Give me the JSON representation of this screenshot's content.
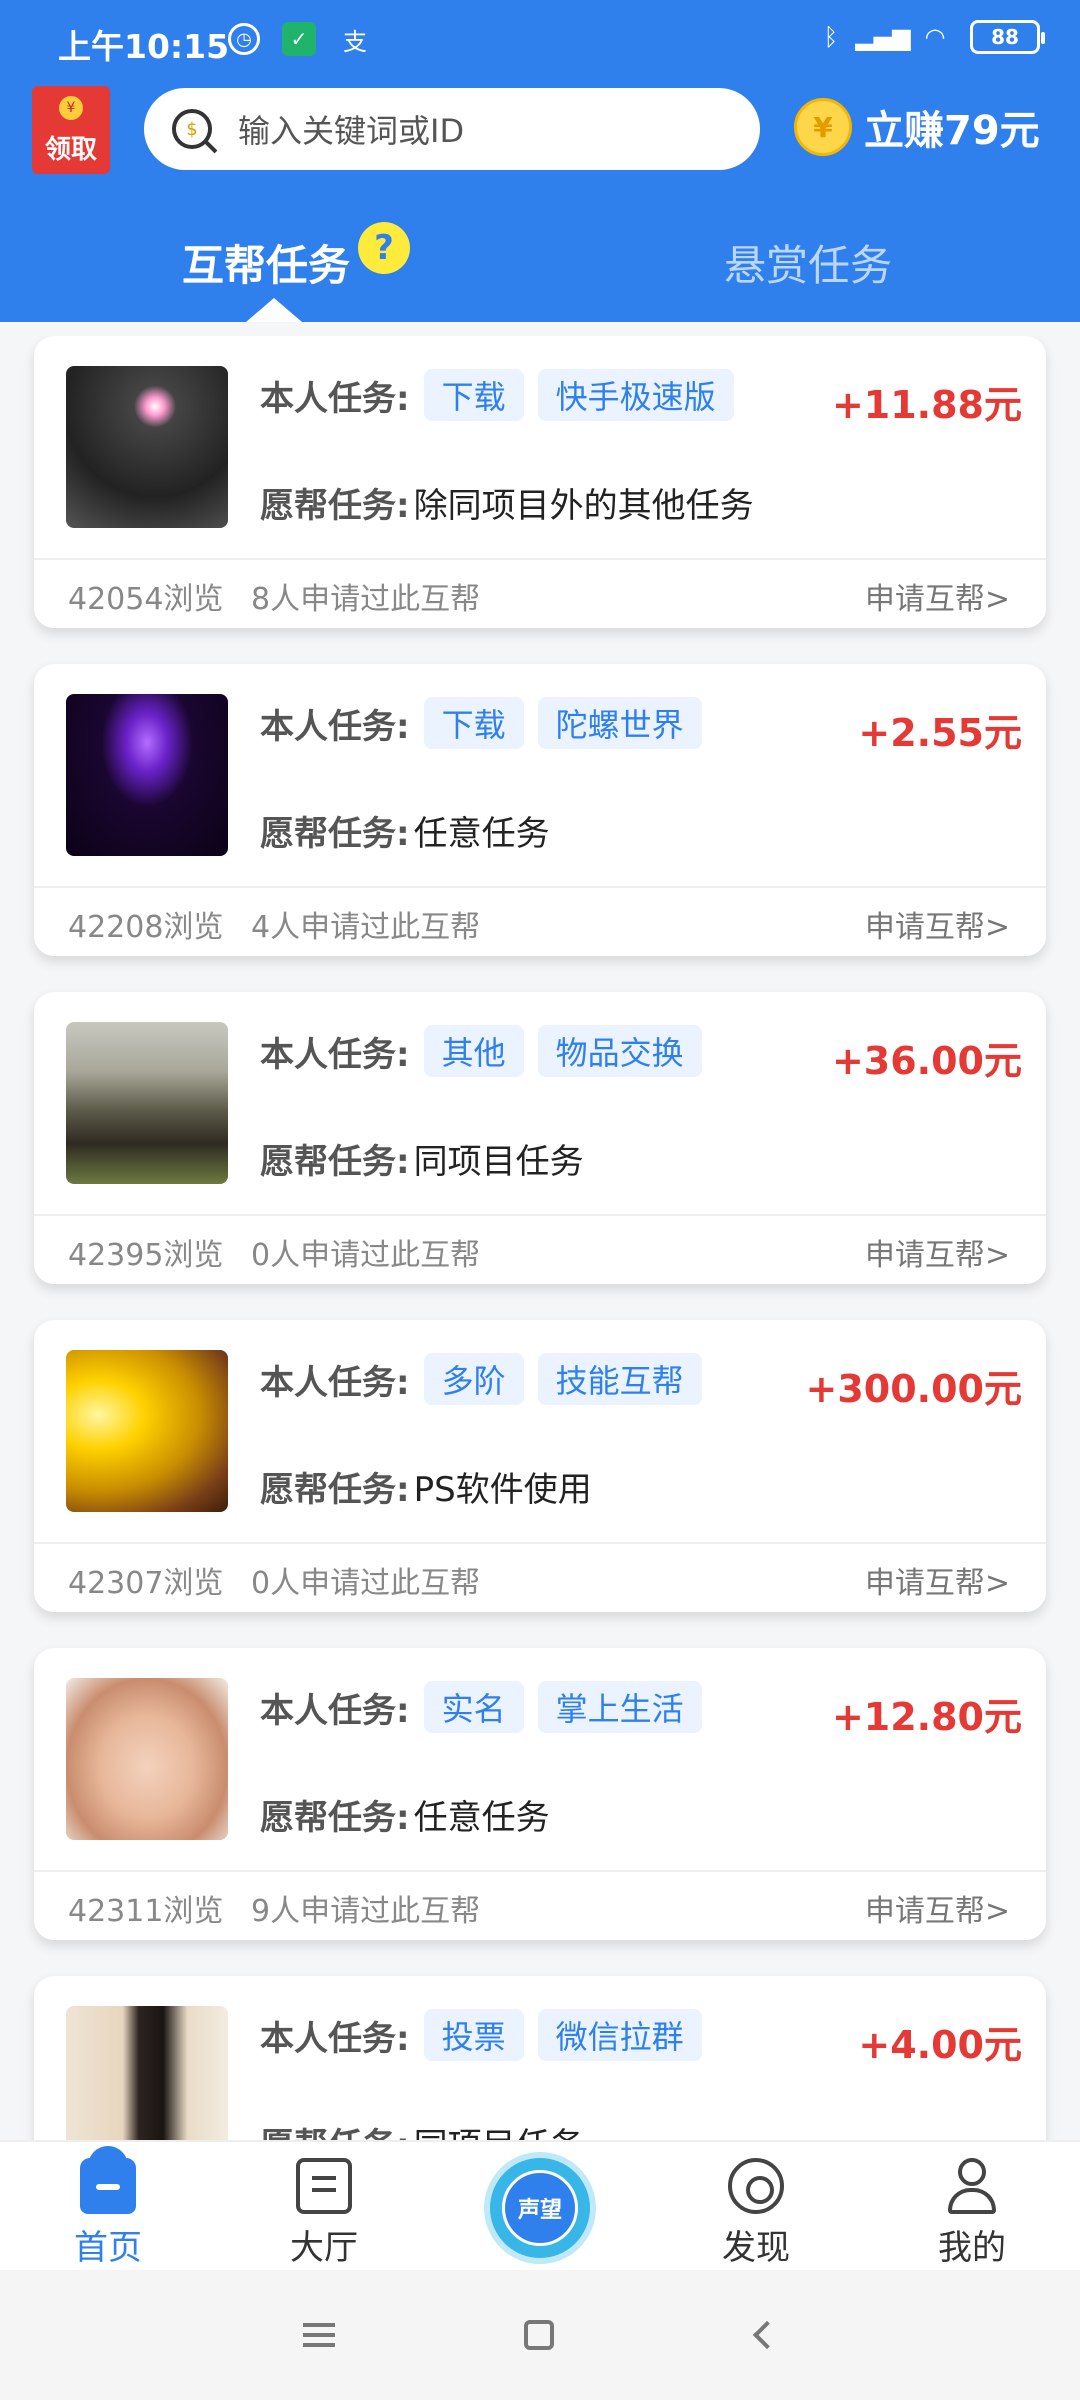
{
  "status_bar": {
    "time": "上午10:15",
    "left_glyph": "支",
    "battery": "88"
  },
  "header": {
    "redpacket_label": "领取",
    "redpacket_symbol": "¥",
    "search_placeholder": "输入关键词或ID",
    "search_symbol": "$",
    "earn_label": "立赚79元",
    "earn_symbol": "¥",
    "tabs": [
      {
        "label": "互帮任务",
        "active": true
      },
      {
        "label": "悬赏任务",
        "active": false
      }
    ],
    "help_badge": "?"
  },
  "cards": [
    {
      "self_label": "本人任务:",
      "tags": [
        "下载",
        "快手极速版"
      ],
      "reward": "+11.88元",
      "want_label": "愿帮任务:",
      "want_value": "除同项目外的其他任务",
      "views": "42054浏览",
      "applicants": "8人申请过此互帮",
      "apply": "申请互帮>"
    },
    {
      "self_label": "本人任务:",
      "tags": [
        "下载",
        "陀螺世界"
      ],
      "reward": "+2.55元",
      "want_label": "愿帮任务:",
      "want_value": "任意任务",
      "views": "42208浏览",
      "applicants": "4人申请过此互帮",
      "apply": "申请互帮>"
    },
    {
      "self_label": "本人任务:",
      "tags": [
        "其他",
        "物品交换"
      ],
      "reward": "+36.00元",
      "want_label": "愿帮任务:",
      "want_value": "同项目任务",
      "views": "42395浏览",
      "applicants": "0人申请过此互帮",
      "apply": "申请互帮>"
    },
    {
      "self_label": "本人任务:",
      "tags": [
        "多阶",
        "技能互帮"
      ],
      "reward": "+300.00元",
      "want_label": "愿帮任务:",
      "want_value": "PS软件使用",
      "views": "42307浏览",
      "applicants": "0人申请过此互帮",
      "apply": "申请互帮>"
    },
    {
      "self_label": "本人任务:",
      "tags": [
        "实名",
        "掌上生活"
      ],
      "reward": "+12.80元",
      "want_label": "愿帮任务:",
      "want_value": "任意任务",
      "views": "42311浏览",
      "applicants": "9人申请过此互帮",
      "apply": "申请互帮>"
    },
    {
      "self_label": "本人任务:",
      "tags": [
        "投票",
        "微信拉群"
      ],
      "reward": "+4.00元",
      "want_label": "愿帮任务:",
      "want_value": "同项目任务",
      "views": "",
      "applicants": "",
      "apply": ""
    }
  ],
  "bottom_nav": {
    "items": [
      {
        "label": "首页",
        "icon": "home-icon",
        "active": true
      },
      {
        "label": "大厅",
        "icon": "hall-icon",
        "active": false
      },
      {
        "label": "声望",
        "icon": "reputation-icon",
        "active": false
      },
      {
        "label": "发现",
        "icon": "discover-icon",
        "active": false
      },
      {
        "label": "我的",
        "icon": "profile-icon",
        "active": false
      }
    ]
  },
  "colors": {
    "brand_blue": "#2f80ed",
    "reward_red": "#e53935",
    "tag_bg": "#eaf3ff"
  }
}
